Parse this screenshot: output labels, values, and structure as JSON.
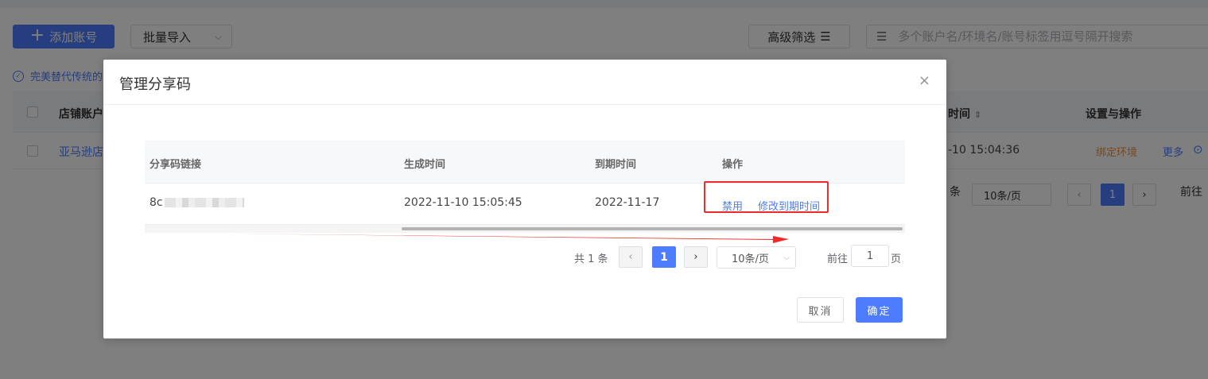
{
  "toolbar": {
    "add_label": "添加账号",
    "batch_label": "批量导入",
    "filter_label": "高级筛选",
    "search_placeholder": "多个账户名/环境名/账号标签用逗号隔开搜索"
  },
  "notice": {
    "text": "完美替代传统的"
  },
  "bg_table": {
    "headers": {
      "shop": "店铺账户",
      "time": "时间",
      "ops": "设置与操作"
    },
    "row": {
      "shop": "亚马逊店",
      "time": "-10 15:04:36",
      "bind": "绑定环境",
      "more": "更多"
    },
    "pager": {
      "count_suffix": "条",
      "page_size": "10条/页",
      "page": "1",
      "goto": "前往"
    }
  },
  "dialog": {
    "title": "管理分享码",
    "close_symbol": "×",
    "table": {
      "headers": [
        "分享码链接",
        "生成时间",
        "到期时间",
        "操作"
      ],
      "rows": [
        {
          "link_prefix": "8c",
          "created": "2022-11-10 15:05:45",
          "expires": "2022-11-17",
          "actions": [
            "禁用",
            "修改到期时间"
          ]
        }
      ]
    },
    "pager": {
      "total": "共 1 条",
      "current_page": "1",
      "page_size": "10条/页",
      "goto_label": "前往",
      "goto_value": "1",
      "goto_suffix": "页"
    },
    "footer": {
      "cancel": "取消",
      "confirm": "确定"
    }
  },
  "colors": {
    "primary": "#4d7cfe",
    "annotation": "#ee2a2a",
    "warning": "#f0903d"
  }
}
